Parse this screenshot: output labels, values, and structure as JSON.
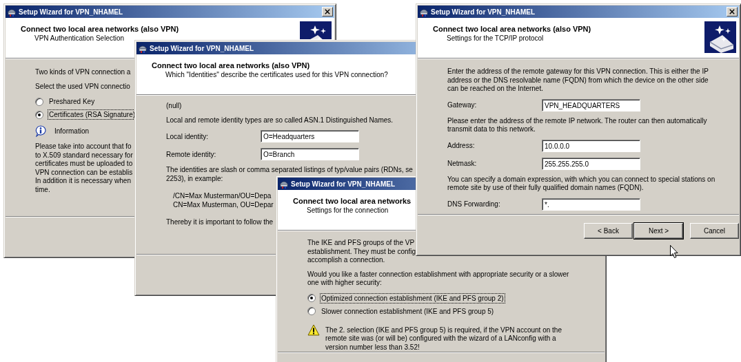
{
  "windows": [
    {
      "title": "Setup Wizard for VPN_NHAMEL",
      "heading": "Connect two local area networks (also VPN)",
      "subheading": "VPN Authentication Selection",
      "items": [
        {
          "kind": "text",
          "lines": [
            "Two kinds of VPN connection a"
          ]
        },
        {
          "kind": "text",
          "lines": [
            "Select the used VPN connectio"
          ]
        },
        {
          "kind": "radio",
          "label": "Preshared Key",
          "selected": false
        },
        {
          "kind": "radio",
          "label": "Certificates (RSA Signature)",
          "selected": true
        },
        {
          "kind": "info",
          "label": "Information"
        },
        {
          "kind": "text",
          "lines": [
            "Please take into account that fo",
            "to X.509 standard necessary for",
            "certificates must be uploaded to",
            "VPN connection can be establis",
            "In addition it is necessary when",
            "time."
          ]
        }
      ]
    },
    {
      "title": "Setup Wizard for VPN_NHAMEL",
      "heading": "Connect two local area networks (also VPN)",
      "subheading": "Which \"Identities\" describe the certificates used for this VPN connection?",
      "items": [
        {
          "kind": "text",
          "lines": [
            "(null)"
          ]
        },
        {
          "kind": "text",
          "lines": [
            "Local and remote identity types are so called ASN.1 Distinguished Names."
          ]
        },
        {
          "kind": "field",
          "label": "Local identity:",
          "value": "O=Headquarters"
        },
        {
          "kind": "field",
          "label": "Remote identity:",
          "value": "O=Branch"
        },
        {
          "kind": "text",
          "lines": [
            "The identities are slash or comma separated listings of typ/value pairs (RDNs, se",
            "2253), in example:"
          ]
        },
        {
          "kind": "example",
          "lines": [
            "/CN=Max Musterman/OU=Depa",
            "CN=Max Musterman, OU=Depar"
          ]
        },
        {
          "kind": "text",
          "lines": [
            "Thereby it is important to follow the"
          ]
        }
      ]
    },
    {
      "title": "Setup Wizard for VPN_NHAMEL",
      "heading": "Connect two local area networks",
      "subheading": "Settings for the connection",
      "items": [
        {
          "kind": "text",
          "lines": [
            "The IKE and PFS groups of the VP",
            "establishment. They must be config",
            "accomplish a connection."
          ]
        },
        {
          "kind": "paragraph",
          "text": "Would you like a faster connection establishment with appropriate security or a slower one with higher security:"
        },
        {
          "kind": "radio",
          "label": "Optimized connection establishment (IKE and PFS group 2)",
          "selected": true
        },
        {
          "kind": "radio",
          "label": "Slower connection establishment (IKE and PFS group 5)",
          "selected": false
        },
        {
          "kind": "warning",
          "text": "The 2. selection (IKE and PFS group 5) is required, if the VPN account on the remote site was (or will be) configured with the wizard of a LANconfig with a version number less than 3.52!"
        }
      ]
    },
    {
      "title": "Setup Wizard for VPN_NHAMEL",
      "heading": "Connect two local area networks (also VPN)",
      "subheading": "Settings for the TCP/IP protocol",
      "items": [
        {
          "kind": "paragraph",
          "text": "Enter the address of the remote gateway for this VPN connection.  This is either the IP address or the DNS resolvable name (FQDN) from which the device on the other side can be reached on the Internet."
        },
        {
          "kind": "field",
          "label": "Gateway:",
          "value": "VPN_HEADQUARTERS"
        },
        {
          "kind": "paragraph",
          "text": "Please enter the address of the remote IP network. The router can then automatically transmit data to this network."
        },
        {
          "kind": "field",
          "label": "Address:",
          "value": "10.0.0.0"
        },
        {
          "kind": "field",
          "label": "Netmask:",
          "value": "255.255.255.0"
        },
        {
          "kind": "paragraph",
          "text": "You can specify a domain expression, with which you can connect to special stations on remote site by use of their fully qualified domain names (FQDN)."
        },
        {
          "kind": "field",
          "label": "DNS Forwarding:",
          "value": "*."
        }
      ],
      "buttons": [
        {
          "label": "< Back",
          "default": false
        },
        {
          "label": "Next >",
          "default": true
        },
        {
          "label": "Cancel",
          "default": false
        }
      ]
    }
  ]
}
